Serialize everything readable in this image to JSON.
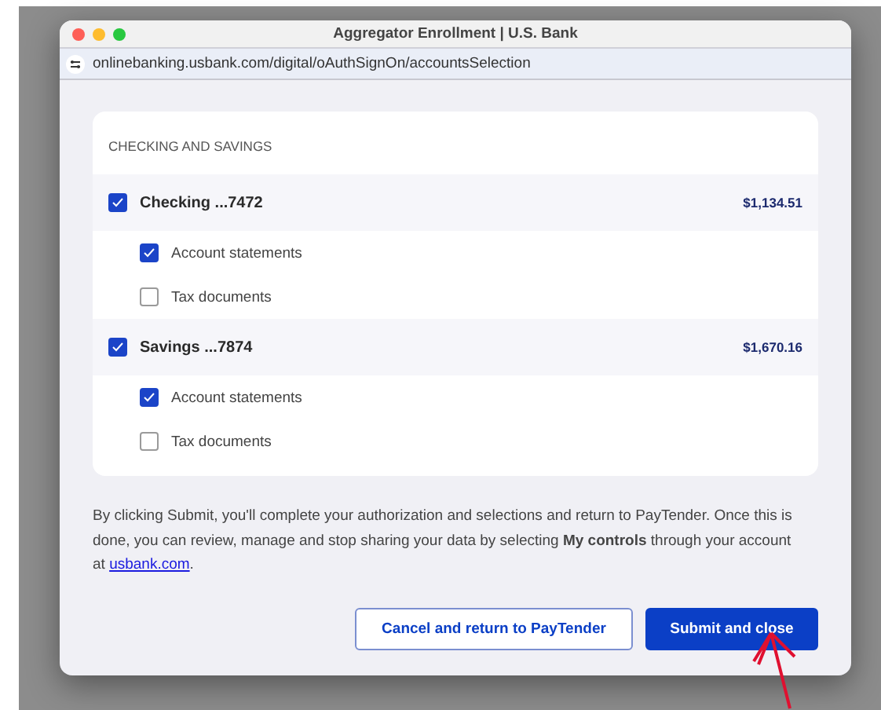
{
  "window": {
    "title": "Aggregator Enrollment | U.S. Bank",
    "url": "onlinebanking.usbank.com/digital/oAuthSignOn/accountsSelection"
  },
  "section": {
    "heading": "CHECKING AND SAVINGS",
    "accounts": [
      {
        "name": "Checking ...7472",
        "balance": "$1,134.51",
        "checked": true,
        "options": [
          {
            "label": "Account statements",
            "checked": true
          },
          {
            "label": "Tax documents",
            "checked": false
          }
        ]
      },
      {
        "name": "Savings ...7874",
        "balance": "$1,670.16",
        "checked": true,
        "options": [
          {
            "label": "Account statements",
            "checked": true
          },
          {
            "label": "Tax documents",
            "checked": false
          }
        ]
      }
    ]
  },
  "notice": {
    "text": "By clicking Submit, you'll complete your authorization and selections and return to PayTender. Once this is done, you can review, manage and stop sharing your data by selecting **My controls** through your account at ",
    "link": "usbank.com",
    "end": "."
  },
  "buttons": [
    {
      "label": "Cancel and return to PayTender",
      "kind": "secondary"
    },
    {
      "label": "Submit and close",
      "kind": "primary"
    }
  ]
}
